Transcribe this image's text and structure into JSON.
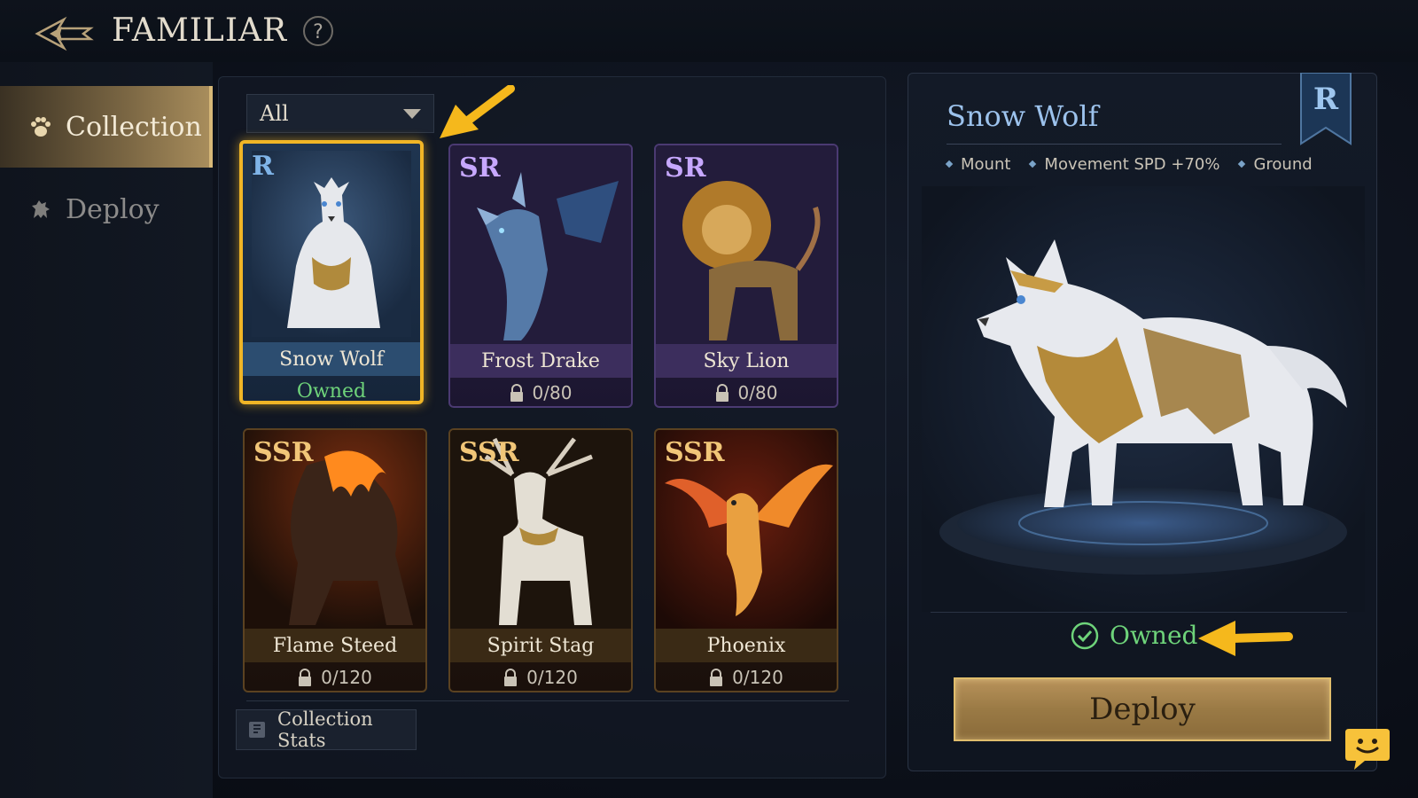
{
  "header": {
    "title": "FAMILIAR",
    "help_label": "?"
  },
  "sidebar": {
    "items": [
      {
        "label": "Collection",
        "icon": "paw-icon",
        "active": true
      },
      {
        "label": "Deploy",
        "icon": "creature-icon",
        "active": false
      }
    ]
  },
  "filter": {
    "selected": "All"
  },
  "cards": [
    {
      "rarity": "R",
      "name": "Snow Wolf",
      "status": "Owned",
      "owned": true,
      "selected": true
    },
    {
      "rarity": "SR",
      "name": "Frost Drake",
      "status": "0/80",
      "owned": false
    },
    {
      "rarity": "SR",
      "name": "Sky Lion",
      "status": "0/80",
      "owned": false
    },
    {
      "rarity": "SSR",
      "name": "Flame Steed",
      "status": "0/120",
      "owned": false
    },
    {
      "rarity": "SSR",
      "name": "Spirit Stag",
      "status": "0/120",
      "owned": false
    },
    {
      "rarity": "SSR",
      "name": "Phoenix",
      "status": "0/120",
      "owned": false
    }
  ],
  "footer": {
    "stats_label": "Collection Stats"
  },
  "detail": {
    "name": "Snow Wolf",
    "rarity": "R",
    "tags": [
      "Mount",
      "Movement SPD +70%",
      "Ground"
    ],
    "status": "Owned",
    "deploy_label": "Deploy"
  },
  "colors": {
    "accent_gold": "#f0b526",
    "owned_green": "#6ed37a",
    "rarity_r": "#7fb4e8",
    "rarity_sr": "#c7a8ff",
    "rarity_ssr": "#f1c678"
  }
}
